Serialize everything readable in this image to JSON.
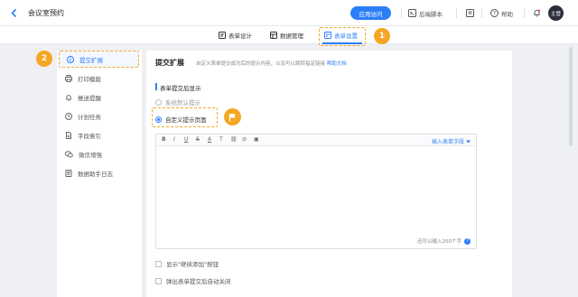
{
  "app": {
    "title": "会议室预约"
  },
  "topbar": {
    "visit_button": "应用访问",
    "backend_script": "后端脚本",
    "help": "帮助",
    "avatar_text": "主管"
  },
  "tabs": [
    {
      "label": "表单设计"
    },
    {
      "label": "数据管理"
    },
    {
      "label": "表单设置"
    }
  ],
  "steps": {
    "one": "1",
    "two": "2"
  },
  "sidebar": {
    "items": [
      {
        "label": "提交扩展"
      },
      {
        "label": "打印模版"
      },
      {
        "label": "推送提醒"
      },
      {
        "label": "计划任务"
      },
      {
        "label": "字段索引"
      },
      {
        "label": "微信增强"
      },
      {
        "label": "数据助手日志"
      }
    ]
  },
  "panel": {
    "title": "提交扩展",
    "description": "自定义表单提交成功后的提示内容，以及可以跳转指定链接",
    "help_link": "帮助文档",
    "section_title": "表单提交后显示",
    "options": [
      {
        "label": "系统默认提示",
        "selected": false
      },
      {
        "label": "自定义提示页面",
        "selected": true
      }
    ],
    "editor": {
      "toolbar": [
        "B",
        "I",
        "U",
        "S",
        "A",
        "T",
        "⛓",
        "⊘",
        "▣"
      ],
      "insert_field": "插入表单字段",
      "char_count": "还可以输入200个字"
    },
    "checkboxes": [
      {
        "label": "显示\"继续添加\"按钮"
      },
      {
        "label": "弹出表单提交后自动关闭"
      }
    ]
  },
  "colors": {
    "accent": "#2c7ef8",
    "highlight": "#f5a623"
  }
}
